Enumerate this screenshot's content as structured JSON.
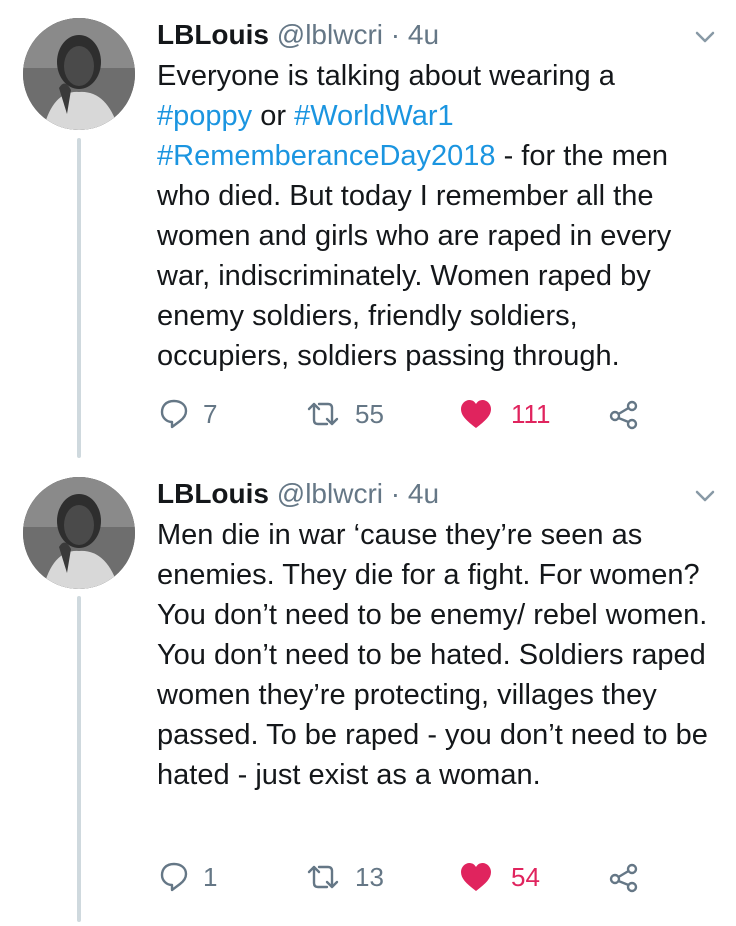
{
  "colors": {
    "accent_link": "#1b95e0",
    "like": "#e0245e",
    "muted": "#657786",
    "text": "#14171a",
    "thread_line": "#cfd9de"
  },
  "tweets": [
    {
      "name": "LBLouis",
      "handle": "@lblwcri",
      "separator": "·",
      "time": "4u",
      "body": [
        {
          "t": "Everyone is talking about wearing a ",
          "tag": false
        },
        {
          "t": "#poppy",
          "tag": true
        },
        {
          "t": " or ",
          "tag": false
        },
        {
          "t": "#WorldWar1",
          "tag": true
        },
        {
          "t": " ",
          "tag": false
        },
        {
          "t": "#RememberanceDay2018",
          "tag": true
        },
        {
          "t": " - for the men who died. But today I remember all the women and girls who are raped in every war, indiscriminately. Women raped by enemy soldiers, friendly soldiers, occupiers, soldiers passing through.",
          "tag": false
        }
      ],
      "replies": "7",
      "retweets": "55",
      "likes": "111",
      "liked": true
    },
    {
      "name": "LBLouis",
      "handle": "@lblwcri",
      "separator": "·",
      "time": "4u",
      "body": [
        {
          "t": "Men die in war ‘cause they’re seen as enemies. They die for a fight. For women? You don’t need to be enemy/ rebel women. You don’t need to be hated. Soldiers raped women they’re protecting, villages they passed. To be raped - you don’t need to be hated - just exist as a woman.",
          "tag": false
        }
      ],
      "replies": "1",
      "retweets": "13",
      "likes": "54",
      "liked": true
    }
  ],
  "icons": {
    "reply": "reply-icon",
    "retweet": "retweet-icon",
    "like": "heart-icon",
    "share": "share-icon",
    "caret": "chevron-down-icon",
    "avatar": "avatar"
  }
}
